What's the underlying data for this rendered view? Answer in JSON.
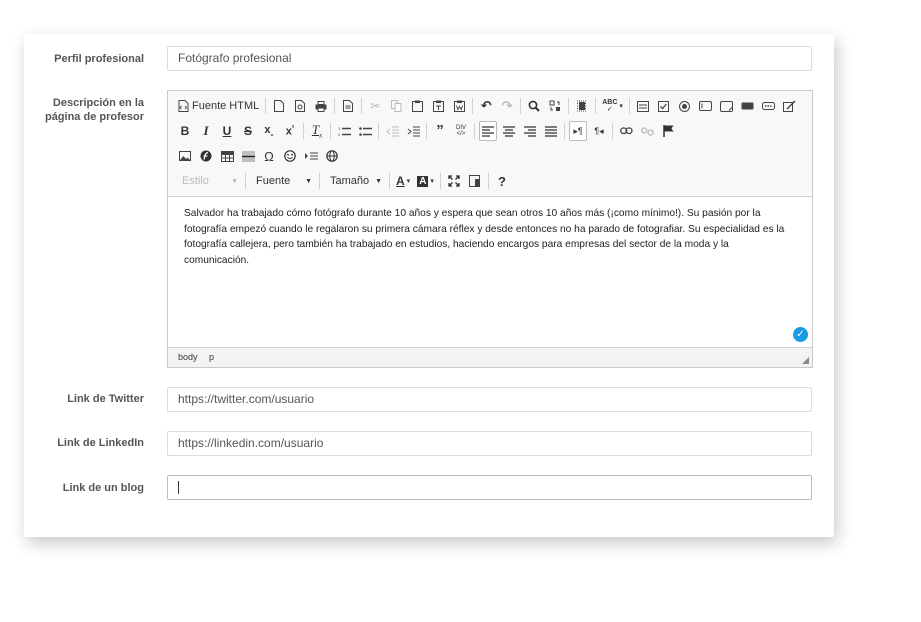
{
  "fields": {
    "perfil": {
      "label": "Perfil profesional",
      "value": "Fotógrafo profesional"
    },
    "descripcion": {
      "label_line1": "Descripción en la",
      "label_line2": "página de profesor"
    },
    "twitter": {
      "label": "Link de Twitter",
      "value": "https://twitter.com/usuario"
    },
    "linkedin": {
      "label": "Link de LinkedIn",
      "value": "https://linkedin.com/usuario"
    },
    "blog": {
      "label": "Link de un blog",
      "value": ""
    }
  },
  "editor": {
    "source_label": "Fuente HTML",
    "style_combo": "Estilo",
    "font_combo": "Fuente",
    "size_combo": "Tamaño",
    "help_glyph": "?",
    "content": "Salvador ha trabajado cómo fotógrafo durante 10 años y espera que sean otros 10 años más (¡como mínimo!). Su pasión por la fotografía empezó cuando le regalaron su primera cámara réflex y desde entonces no ha parado de fotografiar. Su especialidad es la fotografía callejera, pero también ha trabajado en estudios, haciendo encargos para empresas del sector de la moda y la comunicación.",
    "path": [
      "body",
      "p"
    ]
  },
  "colors": {
    "accent": "#1a9be6",
    "border": "#dcdcdc"
  }
}
